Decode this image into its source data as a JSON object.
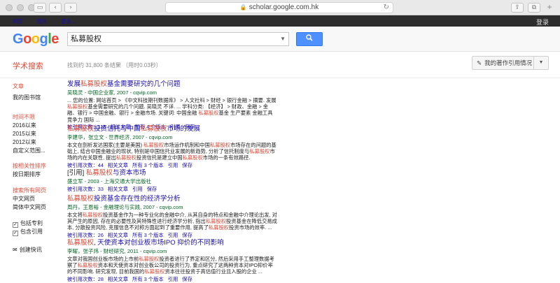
{
  "browser": {
    "url": "scholar.google.com.hk",
    "lock_icon": "lock-icon",
    "reload_icon": "reload-icon"
  },
  "topbar": {
    "links": [
      "网页",
      "图片",
      "更多..."
    ],
    "signin": "登录"
  },
  "search": {
    "logo": [
      "G",
      "o",
      "o",
      "g",
      "l",
      "e"
    ],
    "query": "私募股权",
    "button_icon": "search-icon"
  },
  "toolbar": {
    "scholar_label": "学术搜索",
    "count": "找到约 31,800 条结果 （用时0.03秒）",
    "my_citations": "我的著作引用情况",
    "more_caret": "▼"
  },
  "sidebar": {
    "articles": "文章",
    "my_library": "我的图书馆",
    "time_header": "时间不限",
    "time_items": [
      "2016以来",
      "2015以来",
      "2012以来",
      "自定义范围..."
    ],
    "sort_items": [
      "按相关性排序",
      "按日期排序"
    ],
    "lang_items": [
      "搜索所有网页",
      "中文网页",
      "简体中文网页"
    ],
    "check_items": [
      "包括专利",
      "包含引用"
    ],
    "create_alert": "创建快讯"
  },
  "results": [
    {
      "title_parts": [
        [
          "发展",
          "a"
        ],
        [
          "私募股权",
          "h"
        ],
        [
          "基金需要研究的几个问题",
          "a"
        ]
      ],
      "authors": "吴晓灵 - 中国企业家, 2007 - cqvip.com",
      "snippet_parts": [
        [
          "... 您的位置: 网站首页 > 《中文科技期刊数据库》 > 人文社科 > 财经 > 银行金融 > 摘要. 发展",
          "t"
        ],
        [
          "私募股权",
          "h"
        ],
        [
          "基金需要研究的几个问题. 吴晓灵 不详. ... 学科分类: 【经济】 > 财政、金融 > 金融、银行 > 中国金融、银行 > 金融市场. 关键词: 中国金融 ",
          "t"
        ],
        [
          "私募股权",
          "h"
        ],
        [
          "基金 生产要素 金融工具 竞争力 国际 ...",
          "t"
        ]
      ],
      "links": [
        "被引用次数：115",
        "相关文章",
        "所有 4 个版本",
        "引用",
        "保存"
      ]
    },
    {
      "title_parts": [
        [
          "私募股权",
          "h"
        ],
        [
          "投资信托与中国",
          "a"
        ],
        [
          "私募股权",
          "h"
        ],
        [
          "市场的发展",
          "a"
        ]
      ],
      "authors": "李建华，张立文 - 世界经济, 2007 - cqvip.com",
      "snippet_parts": [
        [
          "本文在剖析发达国家(主要是美国) ",
          "t"
        ],
        [
          "私募股权",
          "h"
        ],
        [
          "市场运作机制和中国",
          "t"
        ],
        [
          "私募股权",
          "h"
        ],
        [
          "市场存在的问题的基础上, 结合中国金融业的现状, 特别是中国信托业发展的新趋势, 分析了信托制度与",
          "t"
        ],
        [
          "私募股权",
          "h"
        ],
        [
          "市场的内在关联性, 提出",
          "t"
        ],
        [
          "私募股权",
          "h"
        ],
        [
          "投资信托是建立中国",
          "t"
        ],
        [
          "私募股权",
          "h"
        ],
        [
          "市场的一条有效路径.",
          "t"
        ]
      ],
      "links": [
        "被引用次数：44",
        "相关文章",
        "所有 3 个版本",
        "引用",
        "保存"
      ]
    },
    {
      "tag": "[引用] ",
      "title_parts": [
        [
          "私募股权",
          "h"
        ],
        [
          "与资本市场",
          "a"
        ]
      ],
      "authors": "盛立军 - 2003 - 上海交通大学出版社",
      "snippet_parts": [],
      "links": [
        "被引用次数：33",
        "相关文章",
        "引用",
        "保存"
      ]
    },
    {
      "title_parts": [
        [
          "私募股权",
          "h"
        ],
        [
          "投资基金存在性的经济学分析",
          "a"
        ]
      ],
      "authors": "周丹，王恩裕 - 金融理论与实践, 2007 - cqvip.com",
      "snippet_parts": [
        [
          "本文将",
          "t"
        ],
        [
          "私募股权",
          "h"
        ],
        [
          "投资基金作为一种专业化的金融中介, 从其自身的特点和金融中介理论出发, 对其产生的原因, 存在的必要性及其特殊性进行经济学分析, 指出",
          "t"
        ],
        [
          "私募股权",
          "h"
        ],
        [
          "投资基金在降低交易成本, 分散投资风险, 克服信息不对称方面起到了重要作用, 提高了",
          "t"
        ],
        [
          "私募股权",
          "h"
        ],
        [
          "投资市场的效率. ...",
          "t"
        ]
      ],
      "links": [
        "被引用次数：26",
        "相关文章",
        "所有 3 个版本",
        "引用",
        "保存"
      ]
    },
    {
      "title_parts": [
        [
          "私募股权",
          "h"
        ],
        [
          ", 天使资本对创业板市场IPO 抑价的不同影响",
          "a"
        ]
      ],
      "authors": "李曜，张子炜 - 财经研究, 2011 - cqvip.com",
      "snippet_parts": [
        [
          "文章对我国创业板市场的上市前",
          "t"
        ],
        [
          "私募股权",
          "h"
        ],
        [
          "投资者进行了界定和区分, 然后采用手工整理数据考察了",
          "t"
        ],
        [
          "私募股权",
          "h"
        ],
        [
          "资本和天使资本对创业板公司的投资行为, 重点研究了这两种资本对IPO抑价率的不同影响. 研究发现, 目前我国的",
          "t"
        ],
        [
          "私募股权",
          "h"
        ],
        [
          "资本往往投资于高估值行业且入股的企业 ...",
          "t"
        ]
      ],
      "links": [
        "被引用次数：28",
        "相关文章",
        "所有 3 个版本",
        "引用",
        "保存"
      ]
    }
  ]
}
